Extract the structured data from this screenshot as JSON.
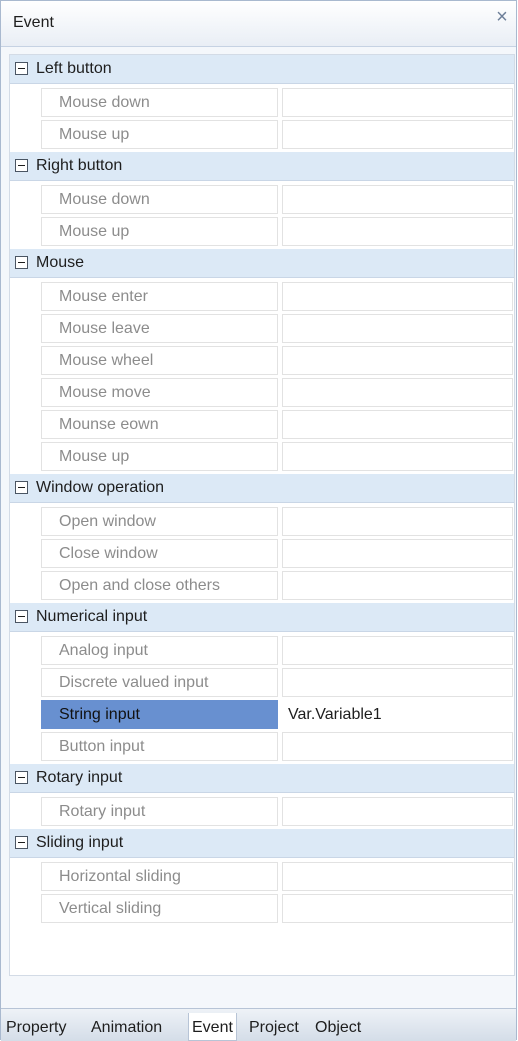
{
  "panel": {
    "title": "Event",
    "close_glyph": "×"
  },
  "groups": [
    {
      "label": "Left button",
      "items": [
        {
          "name": "Mouse down",
          "value": ""
        },
        {
          "name": "Mouse up",
          "value": ""
        }
      ]
    },
    {
      "label": "Right button",
      "items": [
        {
          "name": "Mouse down",
          "value": ""
        },
        {
          "name": "Mouse up",
          "value": ""
        }
      ]
    },
    {
      "label": "Mouse",
      "items": [
        {
          "name": "Mouse enter",
          "value": ""
        },
        {
          "name": "Mouse leave",
          "value": ""
        },
        {
          "name": "Mouse wheel",
          "value": ""
        },
        {
          "name": "Mouse move",
          "value": ""
        },
        {
          "name": "Mounse eown",
          "value": ""
        },
        {
          "name": "Mouse up",
          "value": ""
        }
      ]
    },
    {
      "label": "Window operation",
      "items": [
        {
          "name": "Open window",
          "value": ""
        },
        {
          "name": "Close window",
          "value": ""
        },
        {
          "name": "Open and close others",
          "value": ""
        }
      ]
    },
    {
      "label": "Numerical input",
      "items": [
        {
          "name": "Analog input",
          "value": ""
        },
        {
          "name": "Discrete valued input",
          "value": ""
        },
        {
          "name": "String input",
          "value": "Var.Variable1"
        },
        {
          "name": "Button input",
          "value": ""
        }
      ]
    },
    {
      "label": "Rotary input",
      "items": [
        {
          "name": "Rotary input",
          "value": ""
        }
      ]
    },
    {
      "label": "Sliding input",
      "items": [
        {
          "name": "Horizontal sliding",
          "value": ""
        },
        {
          "name": "Vertical sliding",
          "value": ""
        }
      ]
    }
  ],
  "tabs": [
    {
      "label": "Property",
      "active": false
    },
    {
      "label": "Animation",
      "active": false
    },
    {
      "label": "Event",
      "active": true
    },
    {
      "label": "Project",
      "active": false
    },
    {
      "label": "Object",
      "active": false
    }
  ]
}
